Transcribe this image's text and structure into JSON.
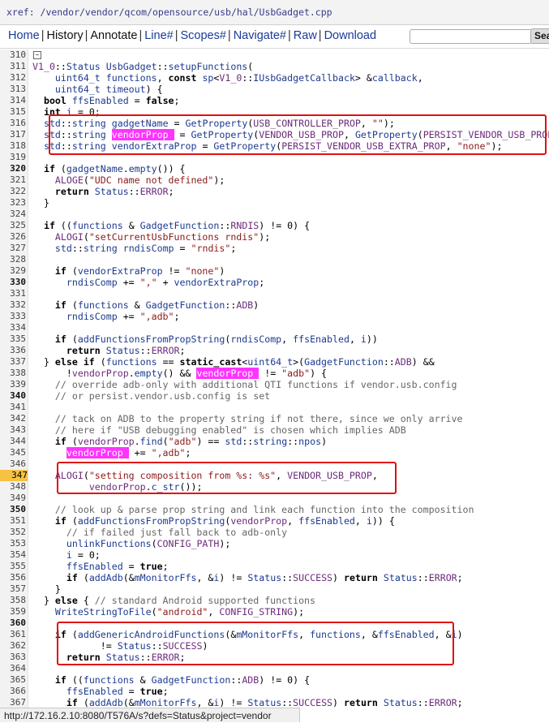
{
  "xref": {
    "path": "xref: /vendor/vendor/qcom/opensource/usb/hal/UsbGadget.cpp"
  },
  "nav": {
    "items": [
      {
        "label": "Home",
        "link": true
      },
      {
        "label": "History",
        "link": false
      },
      {
        "label": "Annotate",
        "link": false
      },
      {
        "label": "Line#",
        "link": true
      },
      {
        "label": "Scopes#",
        "link": true
      },
      {
        "label": "Navigate#",
        "link": true
      },
      {
        "label": "Raw",
        "link": true
      },
      {
        "label": "Download",
        "link": true
      }
    ],
    "search_value": "",
    "search_button": "Search"
  },
  "highlighted_line": "347",
  "code_lines": [
    {
      "n": "310",
      "t": ""
    },
    {
      "n": "311",
      "t": "V1_0::Status UsbGadget::setupFunctions("
    },
    {
      "n": "312",
      "t": "    uint64_t functions, const sp<V1_0::IUsbGadgetCallback> &callback,"
    },
    {
      "n": "313",
      "t": "    uint64_t timeout) {"
    },
    {
      "n": "314",
      "t": "  bool ffsEnabled = false;"
    },
    {
      "n": "315",
      "t": "  int i = 0;"
    },
    {
      "n": "316",
      "t": "  std::string gadgetName = GetProperty(USB_CONTROLLER_PROP, \"\");"
    },
    {
      "n": "317",
      "t": "  std::string vendorProp = GetProperty(VENDOR_USB_PROP, GetProperty(PERSIST_VENDOR_USB_PROP, \"\"));"
    },
    {
      "n": "318",
      "t": "  std::string vendorExtraProp = GetProperty(PERSIST_VENDOR_USB_EXTRA_PROP, \"none\");"
    },
    {
      "n": "319",
      "t": ""
    },
    {
      "n": "320",
      "t": "  if (gadgetName.empty()) {"
    },
    {
      "n": "321",
      "t": "    ALOGE(\"UDC name not defined\");"
    },
    {
      "n": "322",
      "t": "    return Status::ERROR;"
    },
    {
      "n": "323",
      "t": "  }"
    },
    {
      "n": "324",
      "t": ""
    },
    {
      "n": "325",
      "t": "  if ((functions & GadgetFunction::RNDIS) != 0) {"
    },
    {
      "n": "326",
      "t": "    ALOGI(\"setCurrentUsbFunctions rndis\");"
    },
    {
      "n": "327",
      "t": "    std::string rndisComp = \"rndis\";"
    },
    {
      "n": "328",
      "t": ""
    },
    {
      "n": "329",
      "t": "    if (vendorExtraProp != \"none\")"
    },
    {
      "n": "330",
      "t": "      rndisComp += \",\" + vendorExtraProp;"
    },
    {
      "n": "331",
      "t": ""
    },
    {
      "n": "332",
      "t": "    if (functions & GadgetFunction::ADB)"
    },
    {
      "n": "333",
      "t": "      rndisComp += \",adb\";"
    },
    {
      "n": "334",
      "t": ""
    },
    {
      "n": "335",
      "t": "    if (addFunctionsFromPropString(rndisComp, ffsEnabled, i))"
    },
    {
      "n": "336",
      "t": "      return Status::ERROR;"
    },
    {
      "n": "337",
      "t": "  } else if (functions == static_cast<uint64_t>(GadgetFunction::ADB) &&"
    },
    {
      "n": "338",
      "t": "      !vendorProp.empty() && vendorProp != \"adb\") {"
    },
    {
      "n": "339",
      "t": "    // override adb-only with additional QTI functions if vendor.usb.config"
    },
    {
      "n": "340",
      "t": "    // or persist.vendor.usb.config is set"
    },
    {
      "n": "341",
      "t": ""
    },
    {
      "n": "342",
      "t": "    // tack on ADB to the property string if not there, since we only arrive"
    },
    {
      "n": "343",
      "t": "    // here if \"USB debugging enabled\" is chosen which implies ADB"
    },
    {
      "n": "344",
      "t": "    if (vendorProp.find(\"adb\") == std::string::npos)"
    },
    {
      "n": "345",
      "t": "      vendorProp += \",adb\";"
    },
    {
      "n": "346",
      "t": ""
    },
    {
      "n": "347",
      "t": "    ALOGI(\"setting composition from %s: %s\", VENDOR_USB_PROP,"
    },
    {
      "n": "348",
      "t": "          vendorProp.c_str());"
    },
    {
      "n": "349",
      "t": ""
    },
    {
      "n": "350",
      "t": "    // look up & parse prop string and link each function into the composition"
    },
    {
      "n": "351",
      "t": "    if (addFunctionsFromPropString(vendorProp, ffsEnabled, i)) {"
    },
    {
      "n": "352",
      "t": "      // if failed just fall back to adb-only"
    },
    {
      "n": "353",
      "t": "      unlinkFunctions(CONFIG_PATH);"
    },
    {
      "n": "354",
      "t": "      i = 0;"
    },
    {
      "n": "355",
      "t": "      ffsEnabled = true;"
    },
    {
      "n": "356",
      "t": "      if (addAdb(&mMonitorFfs, &i) != Status::SUCCESS) return Status::ERROR;"
    },
    {
      "n": "357",
      "t": "    }"
    },
    {
      "n": "358",
      "t": "  } else { // standard Android supported functions"
    },
    {
      "n": "359",
      "t": "    WriteStringToFile(\"android\", CONFIG_STRING);"
    },
    {
      "n": "360",
      "t": ""
    },
    {
      "n": "361",
      "t": "    if (addGenericAndroidFunctions(&mMonitorFfs, functions, &ffsEnabled, &i)"
    },
    {
      "n": "362",
      "t": "            != Status::SUCCESS)"
    },
    {
      "n": "363",
      "t": "      return Status::ERROR;"
    },
    {
      "n": "364",
      "t": ""
    },
    {
      "n": "365",
      "t": "    if ((functions & GadgetFunction::ADB) != 0) {"
    },
    {
      "n": "366",
      "t": "      ffsEnabled = true;"
    },
    {
      "n": "367",
      "t": "      if (addAdb(&mMonitorFfs, &i) != Status::SUCCESS) return Status::ERROR;"
    }
  ],
  "status_bar": {
    "url": "http://172.16.2.10:8080/T576A/s?defs=Status&project=vendor"
  },
  "colors": {
    "highlight_word": "#ff33ff",
    "annotation_box": "#e01010",
    "line_highlight": "#f5c242"
  }
}
